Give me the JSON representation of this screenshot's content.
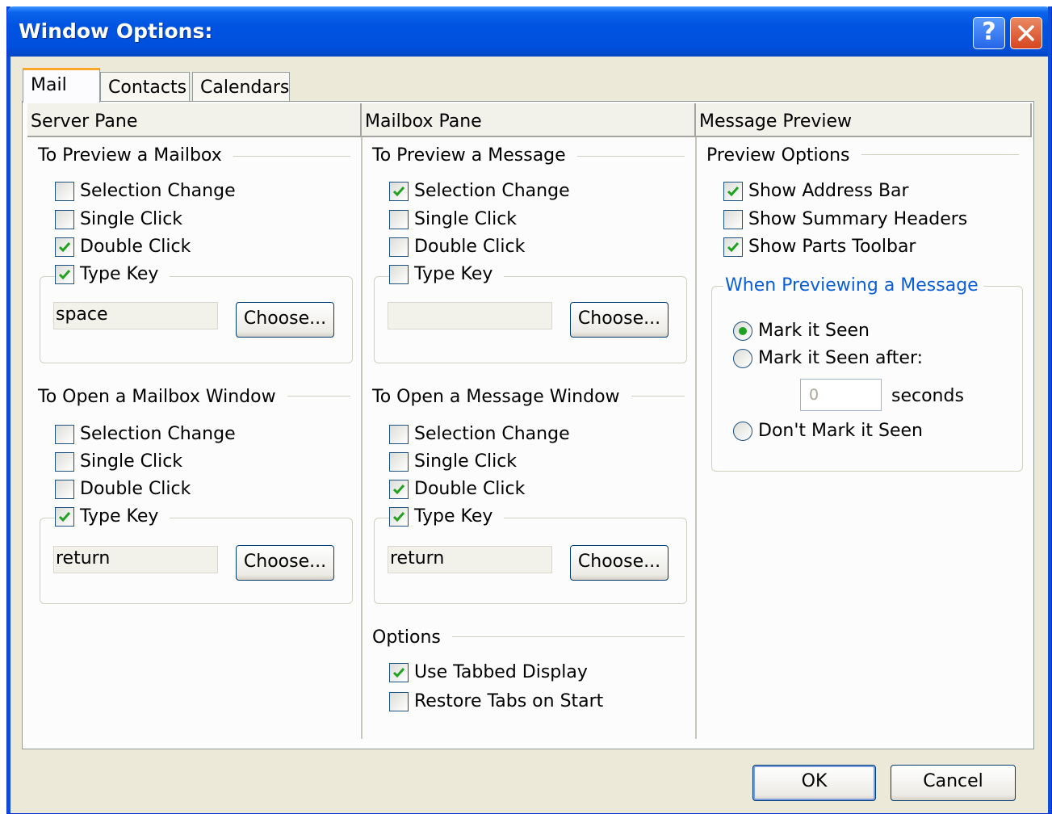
{
  "window": {
    "title": "Window Options:"
  },
  "tabs": [
    {
      "label": "Mail",
      "active": true
    },
    {
      "label": "Contacts",
      "active": false
    },
    {
      "label": "Calendars",
      "active": false
    }
  ],
  "columns": [
    "Server Pane",
    "Mailbox Pane",
    "Message Preview"
  ],
  "server_pane": {
    "preview_title": "To Preview a Mailbox",
    "preview_items": [
      {
        "label": "Selection Change",
        "checked": false
      },
      {
        "label": "Single Click",
        "checked": false
      },
      {
        "label": "Double Click",
        "checked": true
      },
      {
        "label": "Type Key",
        "checked": true
      }
    ],
    "preview_key": "space",
    "open_title": "To Open a Mailbox Window",
    "open_items": [
      {
        "label": "Selection Change",
        "checked": false
      },
      {
        "label": "Single Click",
        "checked": false
      },
      {
        "label": "Double Click",
        "checked": false
      },
      {
        "label": "Type Key",
        "checked": true
      }
    ],
    "open_key": "return",
    "choose_label": "Choose..."
  },
  "mailbox_pane": {
    "preview_title": "To Preview a Message",
    "preview_items": [
      {
        "label": "Selection Change",
        "checked": true
      },
      {
        "label": "Single Click",
        "checked": false
      },
      {
        "label": "Double Click",
        "checked": false
      },
      {
        "label": "Type Key",
        "checked": false
      }
    ],
    "preview_key": "",
    "open_title": "To Open a Message Window",
    "open_items": [
      {
        "label": "Selection Change",
        "checked": false
      },
      {
        "label": "Single Click",
        "checked": false
      },
      {
        "label": "Double Click",
        "checked": true
      },
      {
        "label": "Type Key",
        "checked": true
      }
    ],
    "open_key": "return",
    "choose_label": "Choose...",
    "options_title": "Options",
    "options_items": [
      {
        "label": "Use Tabbed Display",
        "checked": true
      },
      {
        "label": "Restore Tabs on Start",
        "checked": false
      }
    ]
  },
  "message_preview": {
    "options_title": "Preview Options",
    "options_items": [
      {
        "label": "Show Address Bar",
        "checked": true
      },
      {
        "label": "Show Summary Headers",
        "checked": false
      },
      {
        "label": "Show Parts Toolbar",
        "checked": true
      }
    ],
    "when_title": "When Previewing a Message",
    "radios": [
      {
        "label": "Mark it Seen",
        "selected": true
      },
      {
        "label": "Mark it Seen after:",
        "selected": false
      },
      {
        "label": "Don't Mark it Seen",
        "selected": false
      }
    ],
    "seconds_value": "0",
    "seconds_label": "seconds"
  },
  "footer": {
    "ok_label": "OK",
    "cancel_label": "Cancel"
  },
  "colors": {
    "titlebar": "#0053e1",
    "accent_tab": "#f9a927",
    "check": "#21a121",
    "group_link": "#0b5fd6"
  }
}
